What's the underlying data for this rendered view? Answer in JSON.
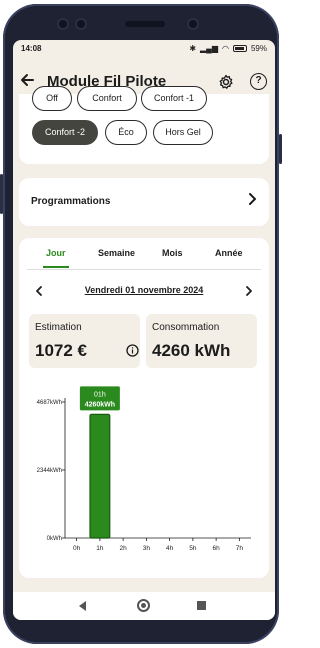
{
  "status_bar": {
    "time": "14:08",
    "battery": "59%"
  },
  "app_bar": {
    "title": "Module Fil Pilote",
    "back_icon": "arrow-left-icon",
    "settings_icon": "gear-icon",
    "help_label": "?"
  },
  "modes": {
    "items": [
      {
        "label": "Off",
        "active": false
      },
      {
        "label": "Confort",
        "active": false
      },
      {
        "label": "Confort -1",
        "active": false
      },
      {
        "label": "Confort -2",
        "active": true
      },
      {
        "label": "Éco",
        "active": false
      },
      {
        "label": "Hors Gel",
        "active": false
      }
    ]
  },
  "programmations": {
    "label": "Programmations"
  },
  "consumption": {
    "tabs": [
      {
        "label": "Jour",
        "active": true
      },
      {
        "label": "Semaine",
        "active": false
      },
      {
        "label": "Mois",
        "active": false
      },
      {
        "label": "Année",
        "active": false
      }
    ],
    "date": "Vendredi 01 novembre 2024",
    "estimation_label": "Estimation",
    "estimation_value": "1072 €",
    "consommation_label": "Consommation",
    "consommation_value": "4260 kWh"
  },
  "chart_data": {
    "type": "bar",
    "categories": [
      "0h",
      "1h",
      "2h",
      "3h",
      "4h",
      "5h",
      "6h",
      "7h"
    ],
    "values": [
      0,
      4260,
      0,
      0,
      0,
      0,
      0,
      0
    ],
    "unit": "kWh",
    "y_ticks": [
      {
        "value": 0,
        "label": "0kWh"
      },
      {
        "value": 2344,
        "label": "2344kWh"
      },
      {
        "value": 4687,
        "label": "4687kWh"
      }
    ],
    "ylim": [
      0,
      4687
    ],
    "tooltip": {
      "category": "01h",
      "value": "4260kWh"
    },
    "bar_color": "#2b8a1e",
    "bar_border_color": "#1a5a10"
  },
  "colors": {
    "accent": "#2b8a1e",
    "background": "#f3eee6",
    "card": "#ffffff",
    "active_chip": "#454540"
  }
}
